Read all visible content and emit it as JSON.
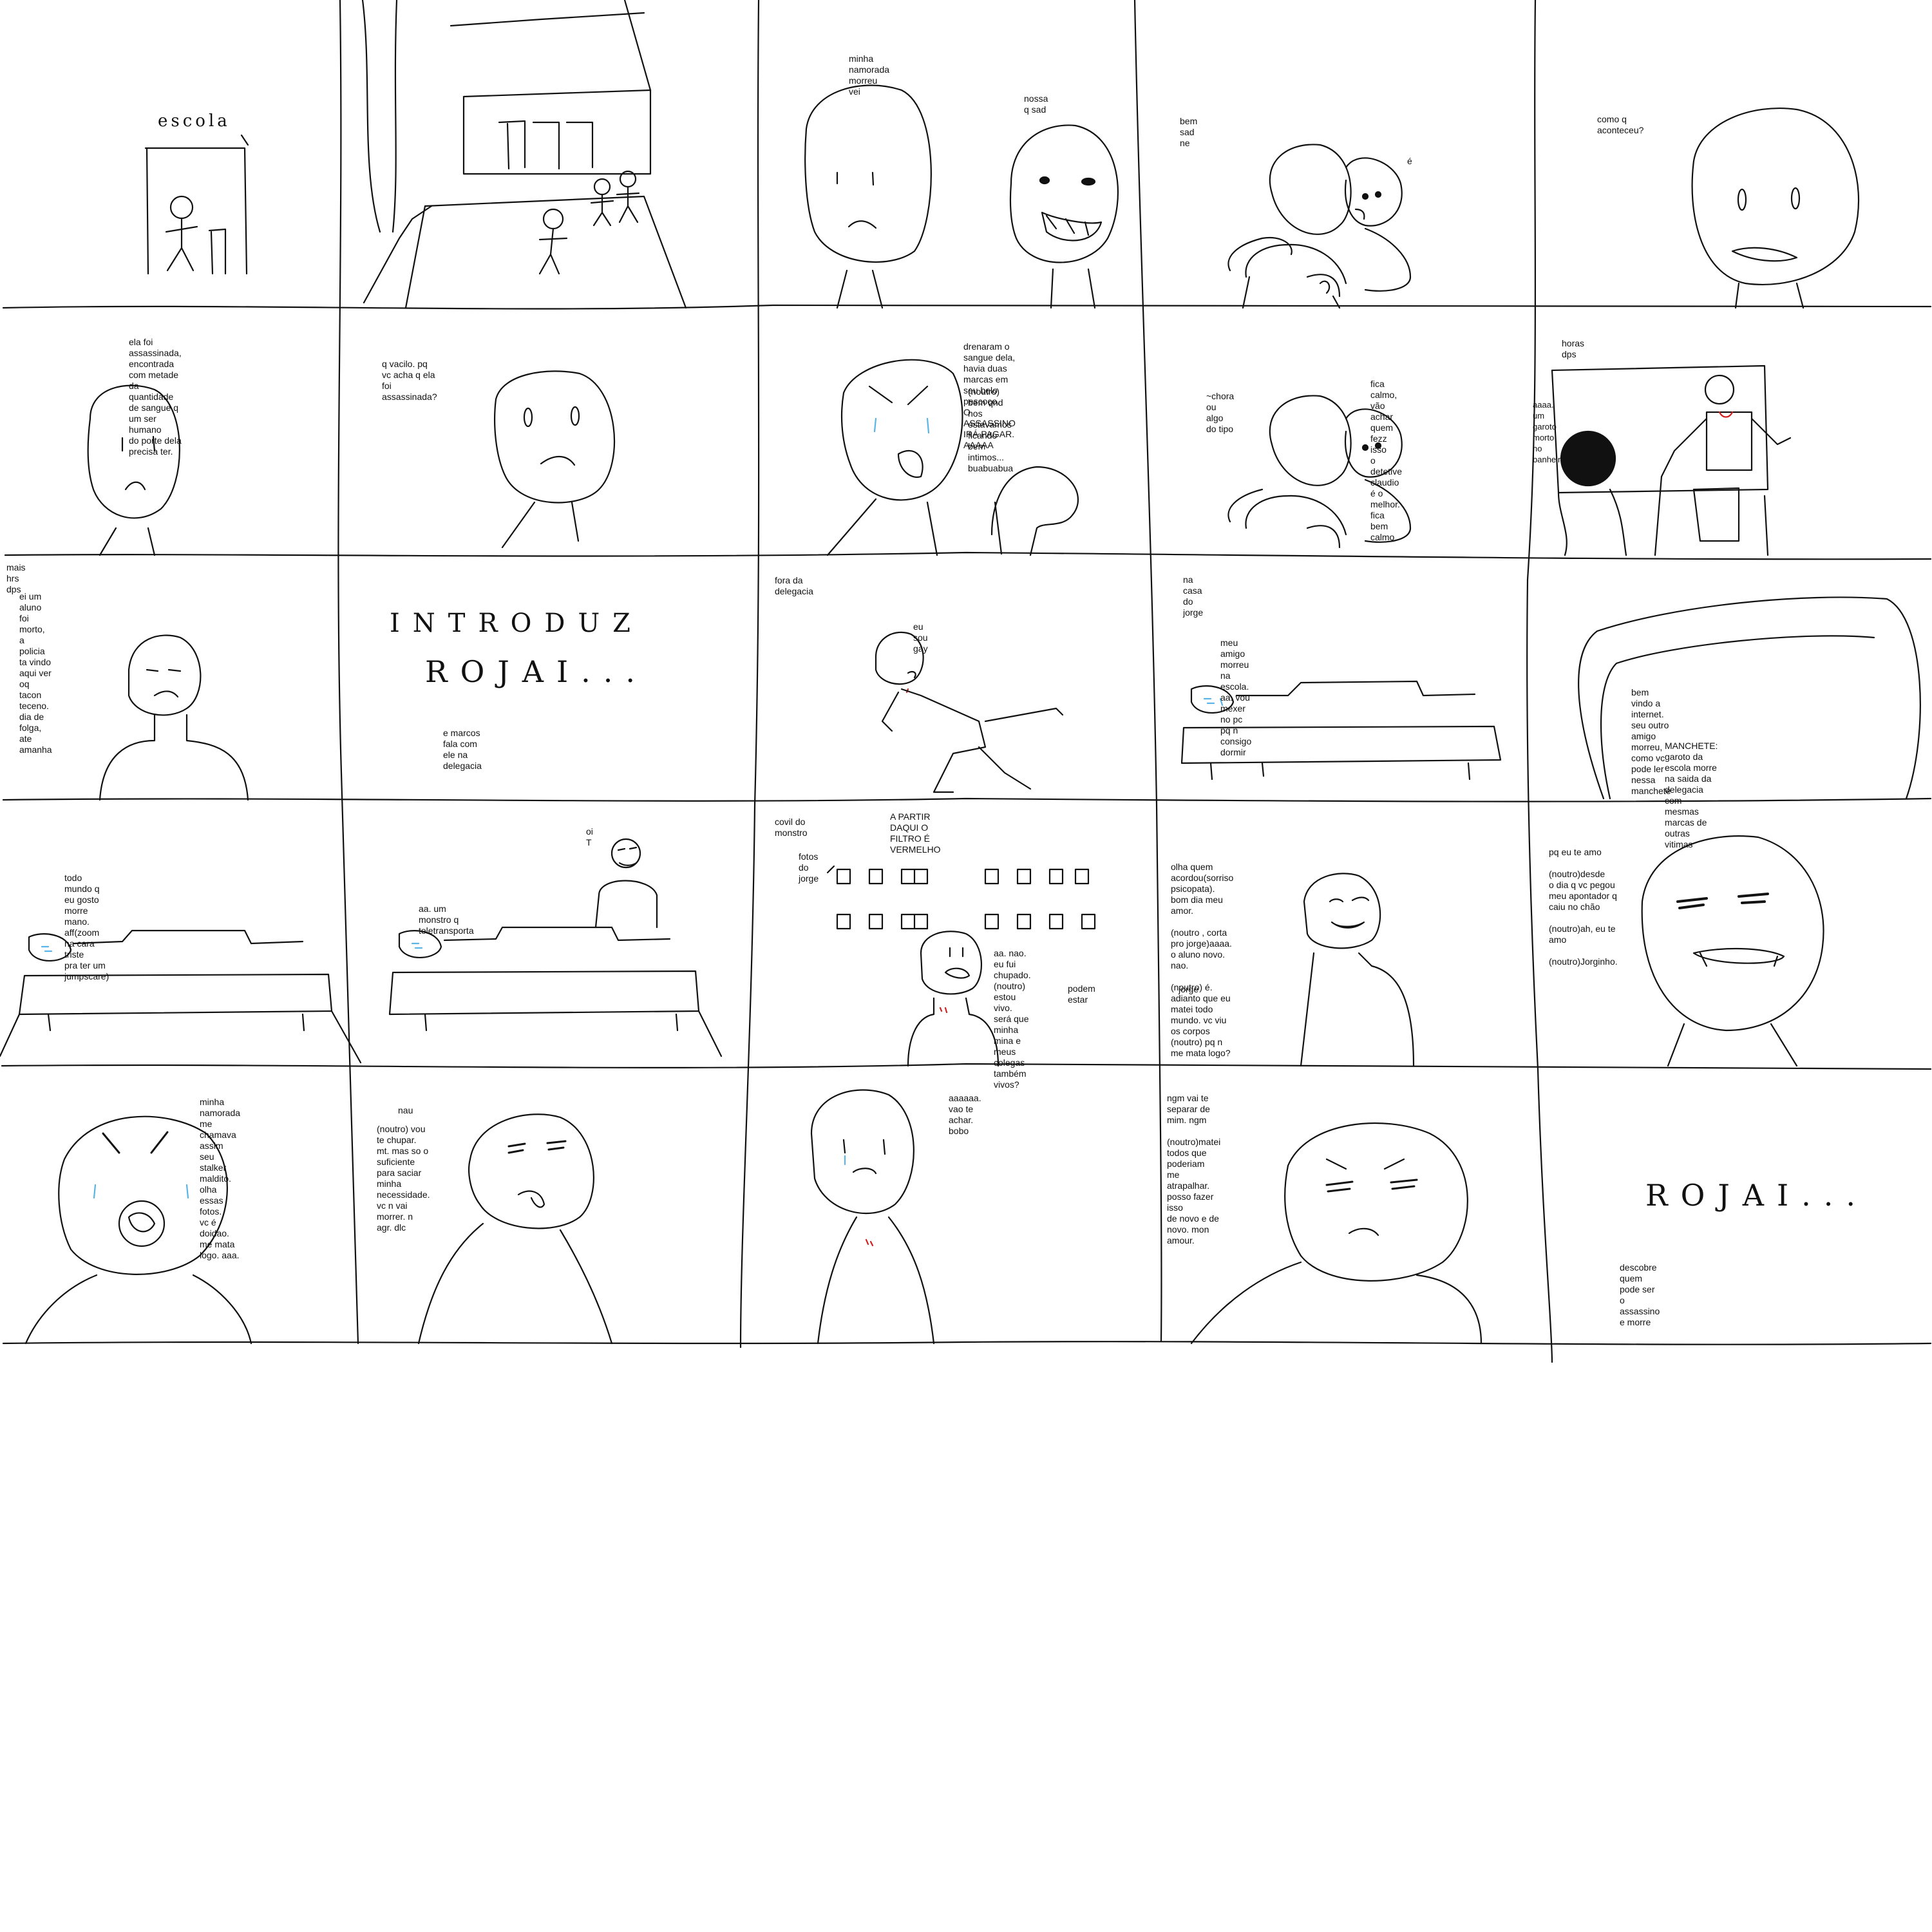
{
  "comic": {
    "row1": {
      "school_sign": "escola",
      "p3_line1": "minha namorada morreu vei",
      "p3_line2": "nossa q sad",
      "p4_line1": "bem sad ne",
      "p4_line2": "é",
      "p5_line1": "como q aconteceu?"
    },
    "row2": {
      "p1_text": "ela foi assassinada, encontrada com metade\nda quantidade de sangue q um ser humano\ndo porte dela precisa ter.",
      "p2_text": "q vacilo. pq vc acha q ela foi\nassassinada?",
      "p3_text": "drenaram o sangue dela, havia duas\nmarcas em seu belo pescoço.\nO ASSASSINO IRÁ PAGAR. AAAAA",
      "p3_text2": "(noutro) bem qnd nos estavamos\n ficando bem intimos... buabuabua",
      "p4_text1": "~chora ou algo\ndo tipo",
      "p4_text2": "fica calmo, vão achar quem fezz isso\no detetive claudio é o melhor. fica\nbem calmo",
      "p5_caption": "horas dps",
      "p5_text": "aaaa. um garoto\nmorto no banheiro"
    },
    "row3": {
      "p1_caption": "mais hrs dps",
      "p1_text": "ei um aluno foi morto, a policia ta vindo aqui ver oq tacon teceno.\ndia de folga, ate amanha",
      "p2_big1": "INTRODUZ",
      "p2_big2": "ROJAI...",
      "p2_text": "e marcos fala com ele na delegacia",
      "p3_caption": "fora da delegacia",
      "p3_text": "eu sou gay",
      "p4_caption": "na casa do jorge",
      "p4_text": "meu amigo morreu na escola. aa. vou mexer no pc pq n consigo\ndormir",
      "p5_text1": "bem vindo a internet. seu outro amigo morreu, como vc pode ler\nnessa manchete",
      "p5_text2": "MANCHETE: garoto da escola morre na saida da delegacia\ncom mesmas marcas de outras vitimas"
    },
    "row4": {
      "p1_text": "todo mundo q eu gosto morre mano. aff(zoom na cara triste\npra ter um jumpscare)",
      "p2_text1": "oi T",
      "p2_text2": "aa. um monstro q teletransporta",
      "p3_caption": "covil do monstro",
      "p3_banner": "A PARTIR DAQUI O FILTRO É VERMELHO",
      "p3_text1": "fotos do jorge",
      "p3_text2": "aa. nao. eu fui chupado.\n(noutro) estou  vivo. será que minha\nmina e meus colegas também vivos?",
      "p3_text3": "podem estar",
      "p4_text": "olha quem acordou(sorriso psicopata).\nbom dia meu amor.\n\n(noutro , corta pro jorge)aaaa.\no aluno novo. nao.\n\n(noutro) é. adianto que eu\nmatei todo mundo. vc viu\n                            os corpos\n(noutro) pq n me mata logo?",
      "p4_name": "jorge",
      "p5_text": "pq eu te amo\n\n(noutro)desde\no dia q vc pegou\nmeu apontador q\ncaiu no chão\n\n(noutro)ah, eu te amo\n\n(noutro)Jorginho."
    },
    "row5": {
      "p1_text": "minha namorada me chamava assim\nseu stalker maldito. olha essas fotos.\nvc é doidao. me mata logo. aaa.",
      "p2_text1": "nau",
      "p2_text2": "(noutro) vou te chupar.\nmt. mas so o suficiente\npara saciar minha\nnecessidade. vc n vai\nmorrer. n agr. dlc",
      "p3_text": "aaaaaa. vao te achar. bobo",
      "p4_text": "ngm vai te separar de mim. ngm\n\n(noutro)matei todos que poderiam\nme atrapalhar. posso fazer isso\nde novo e de novo. mon\namour.",
      "p5_big": "ROJAI...",
      "p5_text": "descobre quem pode ser o assassino e morre"
    }
  },
  "colors": {
    "ink": "#111111",
    "tears": "#5ab4e6",
    "blood": "#d11f1f"
  }
}
